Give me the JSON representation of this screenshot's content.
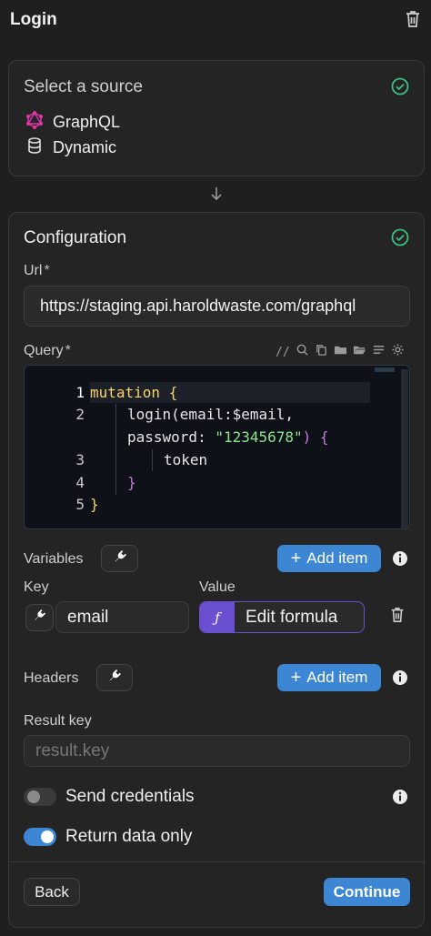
{
  "header": {
    "title": "Login"
  },
  "source": {
    "title": "Select a source",
    "items": [
      {
        "label": "GraphQL",
        "icon": "graphql-icon"
      },
      {
        "label": "Dynamic",
        "icon": "database-icon"
      }
    ]
  },
  "config": {
    "title": "Configuration",
    "url": {
      "label": "Url",
      "required_mark": "*",
      "value": "https://staging.api.haroldwaste.com/graphql"
    },
    "query": {
      "label": "Query",
      "required_mark": "*",
      "toolbar": {
        "comment_label": "//"
      },
      "line_numbers": [
        "1",
        "2",
        "3",
        "4",
        "5"
      ],
      "code": {
        "l1": "mutation {",
        "l2a": "login(email:$email,",
        "l2b_key": "password: ",
        "l2b_str": "\"12345678\"",
        "l2b_end": ") {",
        "l3": "token",
        "l4": "}",
        "l5": "}"
      }
    },
    "variables": {
      "label": "Variables",
      "add_label": "Add item",
      "key_header": "Key",
      "value_header": "Value",
      "rows": [
        {
          "key": "email",
          "value": "Edit formula",
          "formula_glyph": "ƒ"
        }
      ]
    },
    "headers": {
      "label": "Headers",
      "add_label": "Add item"
    },
    "result_key": {
      "label": "Result key",
      "placeholder": "result.key"
    },
    "send_credentials": {
      "label": "Send credentials",
      "on": false
    },
    "return_data_only": {
      "label": "Return data only",
      "on": true
    }
  },
  "footer": {
    "back_label": "Back",
    "continue_label": "Continue"
  },
  "colors": {
    "accent": "#3c86d3",
    "success": "#3fbf7f",
    "formula": "#6b4fd1"
  }
}
